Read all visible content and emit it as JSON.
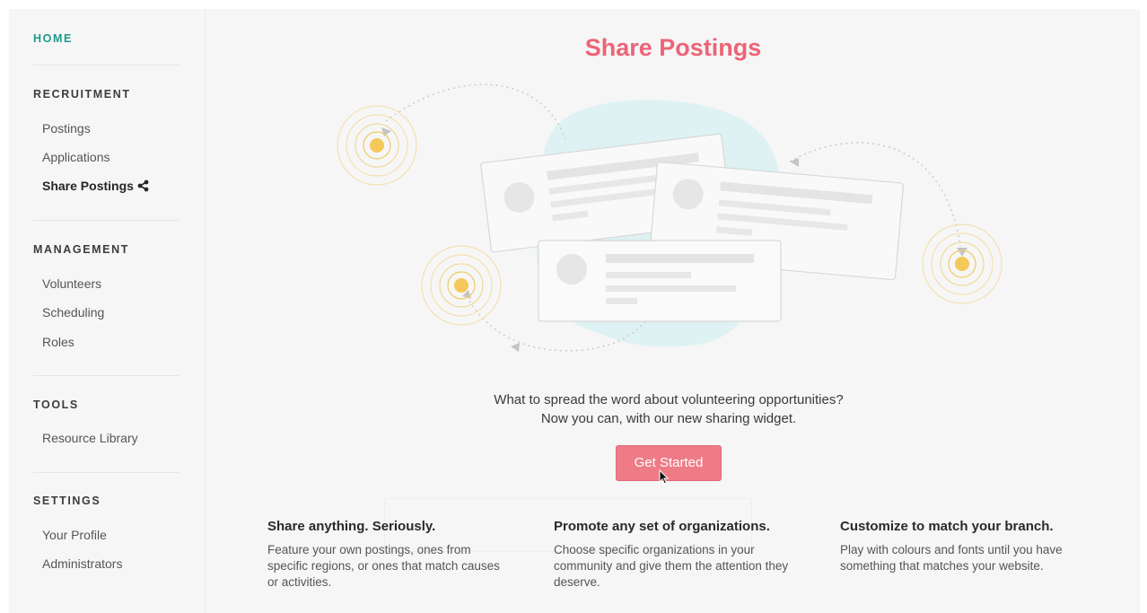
{
  "sidebar": {
    "home": "HOME",
    "sections": [
      {
        "heading": "RECRUITMENT",
        "items": [
          "Postings",
          "Applications",
          "Share Postings"
        ]
      },
      {
        "heading": "MANAGEMENT",
        "items": [
          "Volunteers",
          "Scheduling",
          "Roles"
        ]
      },
      {
        "heading": "TOOLS",
        "items": [
          "Resource Library"
        ]
      },
      {
        "heading": "SETTINGS",
        "items": [
          "Your Profile",
          "Administrators"
        ]
      }
    ],
    "active_item": "Share Postings"
  },
  "main": {
    "title": "Share Postings",
    "tagline_line1": "What to spread the word about volunteering opportunities?",
    "tagline_line2": "Now you can, with our new sharing widget.",
    "cta_label": "Get Started",
    "features": [
      {
        "title": "Share anything. Seriously.",
        "body": "Feature your own postings, ones from specific regions, or ones that match causes or activities."
      },
      {
        "title": "Promote any set of organizations.",
        "body": "Choose specific organizations in your community and give them the attention they deserve."
      },
      {
        "title": "Customize to match your branch.",
        "body": "Play with colours and fonts until you have something that matches your website."
      }
    ]
  },
  "colors": {
    "accent_teal": "#1c9a8d",
    "title_pink": "#ec6477",
    "button_pink": "#ee7b86",
    "blob": "#def2f3",
    "target_yellow": "#f5c85a"
  }
}
